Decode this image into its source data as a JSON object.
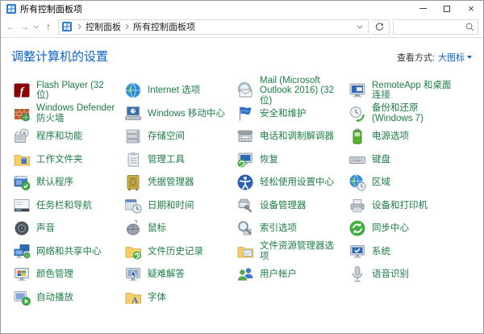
{
  "colors": {
    "accent_blue": "#0a63c9",
    "item_green": "#1d7d46"
  },
  "window": {
    "title": "所有控制面板项",
    "minimize_label": "最小化",
    "maximize_label": "最大化",
    "close_label": "关闭",
    "close_glyph": "×"
  },
  "navbar": {
    "back_glyph": "←",
    "forward_glyph": "→",
    "up_glyph": "↑",
    "breadcrumb_root": "控制面板",
    "breadcrumb_current": "所有控制面板项",
    "search": {
      "value": "",
      "placeholder": ""
    }
  },
  "header": {
    "title": "调整计算机的设置",
    "view_by_label": "查看方式:",
    "view_by_value": "大图标"
  },
  "items": [
    {
      "label": "Flash Player (32 位)",
      "icon": "flash-player"
    },
    {
      "label": "Internet 选项",
      "icon": "internet-options"
    },
    {
      "label": "Mail (Microsoft Outlook 2016) (32 位)",
      "icon": "mail"
    },
    {
      "label": "RemoteApp 和桌面连接",
      "icon": "remoteapp"
    },
    {
      "label": "Windows Defender 防火墙",
      "icon": "defender-firewall"
    },
    {
      "label": "Windows 移动中心",
      "icon": "mobility-center"
    },
    {
      "label": "安全和维护",
      "icon": "security-maintenance"
    },
    {
      "label": "备份和还原(Windows 7)",
      "icon": "backup-restore"
    },
    {
      "label": "程序和功能",
      "icon": "programs-features"
    },
    {
      "label": "存储空间",
      "icon": "storage-spaces"
    },
    {
      "label": "电话和调制解调器",
      "icon": "phone-modem"
    },
    {
      "label": "电源选项",
      "icon": "power-options"
    },
    {
      "label": "工作文件夹",
      "icon": "work-folders"
    },
    {
      "label": "管理工具",
      "icon": "admin-tools"
    },
    {
      "label": "恢复",
      "icon": "recovery"
    },
    {
      "label": "键盘",
      "icon": "keyboard"
    },
    {
      "label": "默认程序",
      "icon": "default-programs"
    },
    {
      "label": "凭据管理器",
      "icon": "credential-manager"
    },
    {
      "label": "轻松使用设置中心",
      "icon": "ease-of-access"
    },
    {
      "label": "区域",
      "icon": "region"
    },
    {
      "label": "任务栏和导航",
      "icon": "taskbar-navigation"
    },
    {
      "label": "日期和时间",
      "icon": "date-time"
    },
    {
      "label": "设备管理器",
      "icon": "device-manager"
    },
    {
      "label": "设备和打印机",
      "icon": "devices-printers"
    },
    {
      "label": "声音",
      "icon": "sound"
    },
    {
      "label": "鼠标",
      "icon": "mouse"
    },
    {
      "label": "索引选项",
      "icon": "indexing-options"
    },
    {
      "label": "同步中心",
      "icon": "sync-center"
    },
    {
      "label": "网络和共享中心",
      "icon": "network-sharing-center"
    },
    {
      "label": "文件历史记录",
      "icon": "file-history"
    },
    {
      "label": "文件资源管理器选项",
      "icon": "file-explorer-options"
    },
    {
      "label": "系统",
      "icon": "system"
    },
    {
      "label": "颜色管理",
      "icon": "color-management"
    },
    {
      "label": "疑难解答",
      "icon": "troubleshooting"
    },
    {
      "label": "用户帐户",
      "icon": "user-accounts"
    },
    {
      "label": "语音识别",
      "icon": "speech-recognition"
    },
    {
      "label": "自动播放",
      "icon": "autoplay"
    },
    {
      "label": "字体",
      "icon": "fonts"
    }
  ]
}
